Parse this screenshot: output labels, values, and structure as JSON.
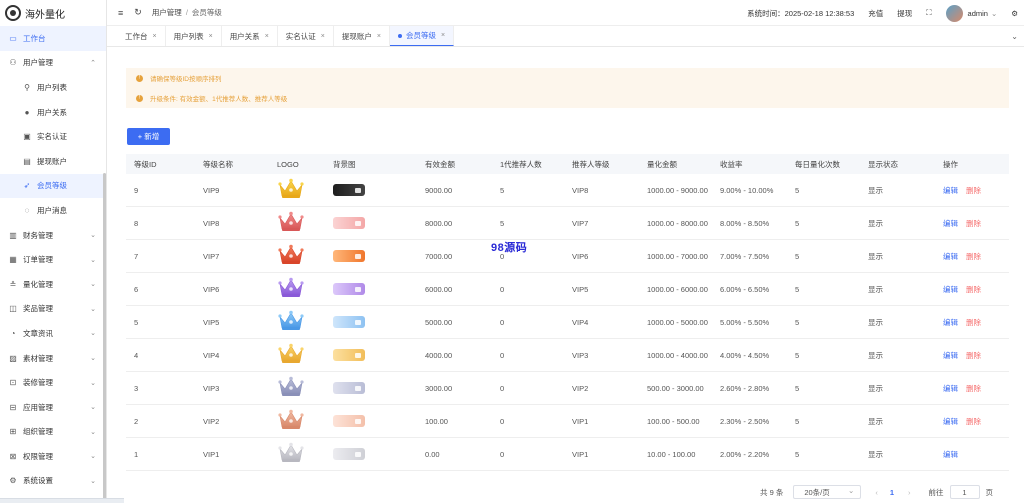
{
  "app": {
    "title": "海外量化"
  },
  "sidebar": {
    "items": [
      {
        "label": "工作台",
        "icon": "monitor-icon",
        "glyph": "▭",
        "level": "top",
        "state": "active-top",
        "arrow": ""
      },
      {
        "label": "用户管理",
        "icon": "user-icon",
        "glyph": "⚇",
        "level": "top",
        "state": "",
        "arrow": "⌃"
      },
      {
        "label": "用户列表",
        "icon": "user-list-icon",
        "glyph": "⚲",
        "level": "sub",
        "state": "",
        "arrow": ""
      },
      {
        "label": "用户关系",
        "icon": "user-relation-icon",
        "glyph": "●",
        "level": "sub",
        "state": "",
        "arrow": ""
      },
      {
        "label": "实名认证",
        "icon": "id-card-icon",
        "glyph": "▣",
        "level": "sub",
        "state": "",
        "arrow": ""
      },
      {
        "label": "提现账户",
        "icon": "wallet-icon",
        "glyph": "▤",
        "level": "sub",
        "state": "",
        "arrow": ""
      },
      {
        "label": "会员等级",
        "icon": "rocket-icon",
        "glyph": "➶",
        "level": "sub",
        "state": "active-sub",
        "arrow": ""
      },
      {
        "label": "用户消息",
        "icon": "message-icon",
        "glyph": "◌",
        "level": "sub",
        "state": "",
        "arrow": ""
      },
      {
        "label": "财务管理",
        "icon": "finance-icon",
        "glyph": "▥",
        "level": "top",
        "state": "",
        "arrow": "⌄"
      },
      {
        "label": "订单管理",
        "icon": "order-icon",
        "glyph": "▦",
        "level": "top",
        "state": "",
        "arrow": "⌄"
      },
      {
        "label": "量化管理",
        "icon": "quant-icon",
        "glyph": "≗",
        "level": "top",
        "state": "",
        "arrow": "⌄"
      },
      {
        "label": "奖品管理",
        "icon": "prize-icon",
        "glyph": "◫",
        "level": "top",
        "state": "",
        "arrow": "⌄"
      },
      {
        "label": "文章资讯",
        "icon": "article-icon",
        "glyph": "◔",
        "level": "top",
        "state": "",
        "arrow": "⌄"
      },
      {
        "label": "素材管理",
        "icon": "material-icon",
        "glyph": "▨",
        "level": "top",
        "state": "",
        "arrow": "⌄"
      },
      {
        "label": "装修管理",
        "icon": "decor-icon",
        "glyph": "⊡",
        "level": "top",
        "state": "",
        "arrow": "⌄"
      },
      {
        "label": "应用管理",
        "icon": "app-icon",
        "glyph": "⊟",
        "level": "top",
        "state": "",
        "arrow": "⌄"
      },
      {
        "label": "组织管理",
        "icon": "org-icon",
        "glyph": "⊞",
        "level": "top",
        "state": "",
        "arrow": "⌄"
      },
      {
        "label": "权限管理",
        "icon": "permission-icon",
        "glyph": "⊠",
        "level": "top",
        "state": "",
        "arrow": "⌄"
      },
      {
        "label": "系统设置",
        "icon": "settings-icon",
        "glyph": "⚙",
        "level": "top",
        "state": "",
        "arrow": "⌄"
      }
    ]
  },
  "header": {
    "breadcrumb": [
      "用户管理",
      "会员等级"
    ],
    "system_time": "系统时间：2025-02-18 12:38:53",
    "recharge": "充值",
    "withdraw": "提现",
    "username": "admin"
  },
  "tabs": [
    {
      "label": "工作台",
      "active": false
    },
    {
      "label": "用户列表",
      "active": false
    },
    {
      "label": "用户关系",
      "active": false
    },
    {
      "label": "实名认证",
      "active": false
    },
    {
      "label": "提现账户",
      "active": false
    },
    {
      "label": "会员等级",
      "active": true
    }
  ],
  "alerts": [
    "请确保等级ID按顺序排列",
    "升级条件: 有效金额、1代推荐人数、推荐人等级"
  ],
  "toolbar": {
    "add_label": "+ 新增"
  },
  "table": {
    "columns": [
      "等级ID",
      "等级名称",
      "LOGO",
      "背景图",
      "有效金额",
      "1代推荐人数",
      "推荐人等级",
      "量化金额",
      "收益率",
      "每日量化次数",
      "显示状态",
      "操作"
    ],
    "edit_label": "编辑",
    "delete_label": "删除",
    "rows": [
      {
        "id": "9",
        "name": "VIP9",
        "crown": [
          "#f9d44a",
          "#e8a81a"
        ],
        "card": [
          "#1e1e1e",
          "#444"
        ],
        "amount": "9000.00",
        "ref": "5",
        "ref_level": "VIP8",
        "quant": "1000.00 - 9000.00",
        "rate": "9.00% - 10.00%",
        "times": "5",
        "status": "显示",
        "deletable": true
      },
      {
        "id": "8",
        "name": "VIP8",
        "crown": [
          "#f08a8a",
          "#d85858"
        ],
        "card": [
          "#fbd3d3",
          "#f4a7a7"
        ],
        "amount": "8000.00",
        "ref": "5",
        "ref_level": "VIP7",
        "quant": "1000.00 - 8000.00",
        "rate": "8.00% - 8.50%",
        "times": "5",
        "status": "显示",
        "deletable": true
      },
      {
        "id": "7",
        "name": "VIP7",
        "crown": [
          "#f07a5a",
          "#d9452a"
        ],
        "card": [
          "#ffb77a",
          "#f0762c"
        ],
        "amount": "7000.00",
        "ref": "0",
        "ref_level": "VIP6",
        "quant": "1000.00 - 7000.00",
        "rate": "7.00% - 7.50%",
        "times": "5",
        "status": "显示",
        "deletable": true
      },
      {
        "id": "6",
        "name": "VIP6",
        "crown": [
          "#b89af0",
          "#8a5ad8"
        ],
        "card": [
          "#dcc8fa",
          "#b08ae8"
        ],
        "amount": "6000.00",
        "ref": "0",
        "ref_level": "VIP5",
        "quant": "1000.00 - 6000.00",
        "rate": "6.00% - 6.50%",
        "times": "5",
        "status": "显示",
        "deletable": true
      },
      {
        "id": "5",
        "name": "VIP5",
        "crown": [
          "#8ecaf8",
          "#4a98e6"
        ],
        "card": [
          "#cfe6fb",
          "#8ec2f2"
        ],
        "amount": "5000.00",
        "ref": "0",
        "ref_level": "VIP4",
        "quant": "1000.00 - 5000.00",
        "rate": "5.00% - 5.50%",
        "times": "5",
        "status": "显示",
        "deletable": true
      },
      {
        "id": "4",
        "name": "VIP4",
        "crown": [
          "#fad46a",
          "#e8a830"
        ],
        "card": [
          "#fce0a0",
          "#f2be5a"
        ],
        "amount": "4000.00",
        "ref": "0",
        "ref_level": "VIP3",
        "quant": "1000.00 - 4000.00",
        "rate": "4.00% - 4.50%",
        "times": "5",
        "status": "显示",
        "deletable": true
      },
      {
        "id": "3",
        "name": "VIP3",
        "crown": [
          "#b8bcd8",
          "#8a90b8"
        ],
        "card": [
          "#dfe1ee",
          "#b9bdd6"
        ],
        "amount": "3000.00",
        "ref": "0",
        "ref_level": "VIP2",
        "quant": "500.00 - 3000.00",
        "rate": "2.60% - 2.80%",
        "times": "5",
        "status": "显示",
        "deletable": true
      },
      {
        "id": "2",
        "name": "VIP2",
        "crown": [
          "#f0b8a0",
          "#d8886a"
        ],
        "card": [
          "#fde3d8",
          "#f4c0aa"
        ],
        "amount": "100.00",
        "ref": "0",
        "ref_level": "VIP1",
        "quant": "100.00 - 500.00",
        "rate": "2.30% - 2.50%",
        "times": "5",
        "status": "显示",
        "deletable": true
      },
      {
        "id": "1",
        "name": "VIP1",
        "crown": [
          "#e4e4e8",
          "#b8b8c0"
        ],
        "card": [
          "#ececf0",
          "#cfd0d6"
        ],
        "amount": "0.00",
        "ref": "0",
        "ref_level": "VIP1",
        "quant": "10.00 - 100.00",
        "rate": "2.00% - 2.20%",
        "times": "5",
        "status": "显示",
        "deletable": false
      }
    ]
  },
  "pagination": {
    "total": "共 9 条",
    "page_size": "20条/页",
    "current": "1",
    "goto_label": "前往",
    "goto_value": "1",
    "page_suffix": "页"
  },
  "watermark": "98源码",
  "colors": {
    "primary": "#3c6cf2",
    "danger": "#f56c6c",
    "warning": "#e6a23c"
  }
}
